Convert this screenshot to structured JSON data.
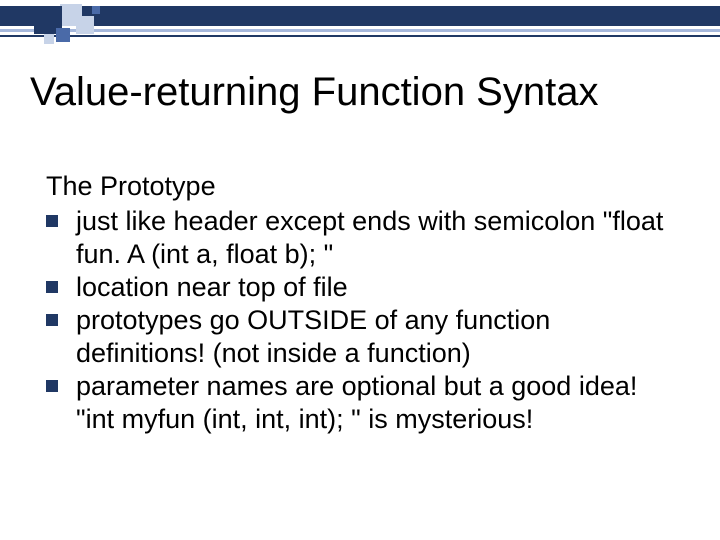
{
  "title": "Value-returning Function Syntax",
  "section_heading": "The Prototype",
  "bullets": [
    "just like header except ends with semicolon  \"float fun. A (int a, float b); \"",
    "location near top of file",
    "prototypes go OUTSIDE of any function definitions!  (not inside a function)",
    "parameter names are optional but a good idea!   \"int myfun (int, int, int); \" is mysterious!"
  ]
}
